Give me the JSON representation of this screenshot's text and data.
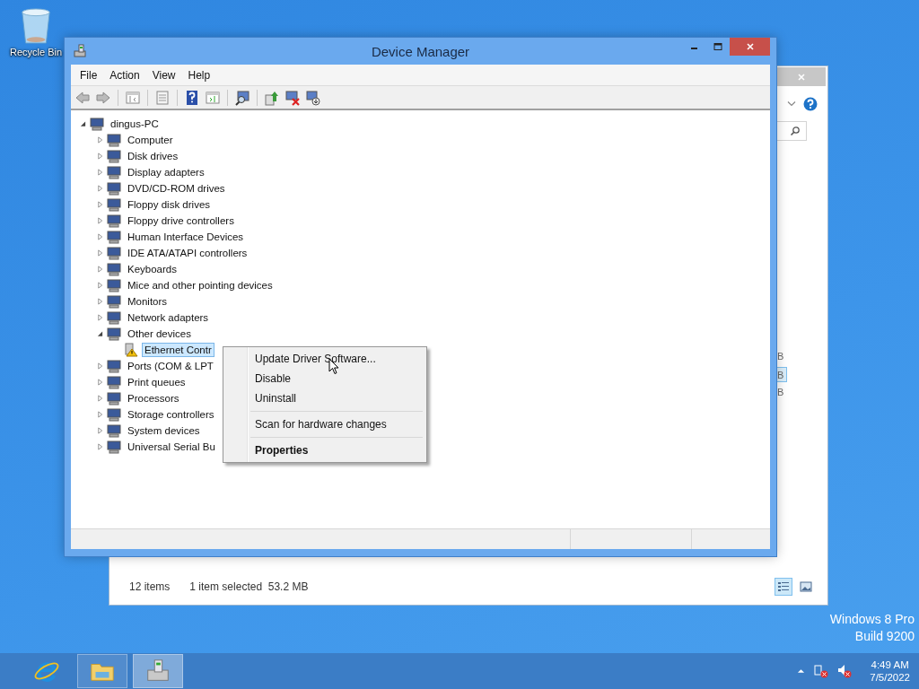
{
  "desktop": {
    "icons": [
      {
        "label": "Recycle Bin"
      }
    ],
    "watermark": [
      "Windows 8 Pro",
      "Build 9200"
    ]
  },
  "background_window": {
    "list_fragments": [
      {
        "text": "B",
        "selected": false
      },
      {
        "text": "B",
        "selected": true
      },
      {
        "text": "B",
        "selected": false
      }
    ],
    "status_bar": [
      "12 items",
      "1 item selected  53.2 MB"
    ],
    "views": [
      {
        "kind": "details",
        "selected": true
      },
      {
        "kind": "thumbnails",
        "selected": false
      }
    ]
  },
  "window": {
    "title": "Device Manager",
    "menu": [
      "File",
      "Action",
      "View",
      "Help"
    ],
    "tree": {
      "label": "dingus-PC",
      "expanded": true,
      "selected": false,
      "children": [
        {
          "label": "Computer",
          "expanded": false,
          "selected": false
        },
        {
          "label": "Disk drives",
          "expanded": false,
          "selected": false
        },
        {
          "label": "Display adapters",
          "expanded": false,
          "selected": false
        },
        {
          "label": "DVD/CD-ROM drives",
          "expanded": false,
          "selected": false
        },
        {
          "label": "Floppy disk drives",
          "expanded": false,
          "selected": false
        },
        {
          "label": "Floppy drive controllers",
          "expanded": false,
          "selected": false
        },
        {
          "label": "Human Interface Devices",
          "expanded": false,
          "selected": false
        },
        {
          "label": "IDE ATA/ATAPI controllers",
          "expanded": false,
          "selected": false
        },
        {
          "label": "Keyboards",
          "expanded": false,
          "selected": false
        },
        {
          "label": "Mice and other pointing devices",
          "expanded": false,
          "selected": false
        },
        {
          "label": "Monitors",
          "expanded": false,
          "selected": false
        },
        {
          "label": "Network adapters",
          "expanded": false,
          "selected": false
        },
        {
          "label": "Other devices",
          "expanded": true,
          "selected": false,
          "children": [
            {
              "label": "Ethernet Contr",
              "selected": true,
              "warning": true
            }
          ]
        },
        {
          "label": "Ports (COM & LPT",
          "expanded": false,
          "selected": false
        },
        {
          "label": "Print queues",
          "expanded": false,
          "selected": false
        },
        {
          "label": "Processors",
          "expanded": false,
          "selected": false
        },
        {
          "label": "Storage controllers",
          "expanded": false,
          "selected": false
        },
        {
          "label": "System devices",
          "expanded": false,
          "selected": false
        },
        {
          "label": "Universal Serial Bu",
          "expanded": false,
          "selected": false
        }
      ]
    }
  },
  "context_menu": {
    "groups": [
      [
        {
          "label": "Update Driver Software...",
          "default": false
        },
        {
          "label": "Disable",
          "default": false
        },
        {
          "label": "Uninstall",
          "default": false
        }
      ],
      [
        {
          "label": "Scan for hardware changes",
          "default": false
        }
      ],
      [
        {
          "label": "Properties",
          "default": true
        }
      ]
    ]
  },
  "taskbar": {
    "apps": [
      {
        "kind": "browser",
        "selected": false
      },
      {
        "kind": "folder",
        "selected": false
      },
      {
        "kind": "device-manager",
        "selected": true
      }
    ],
    "clock": {
      "time": "4:49 AM",
      "date": "7/5/2022"
    }
  }
}
